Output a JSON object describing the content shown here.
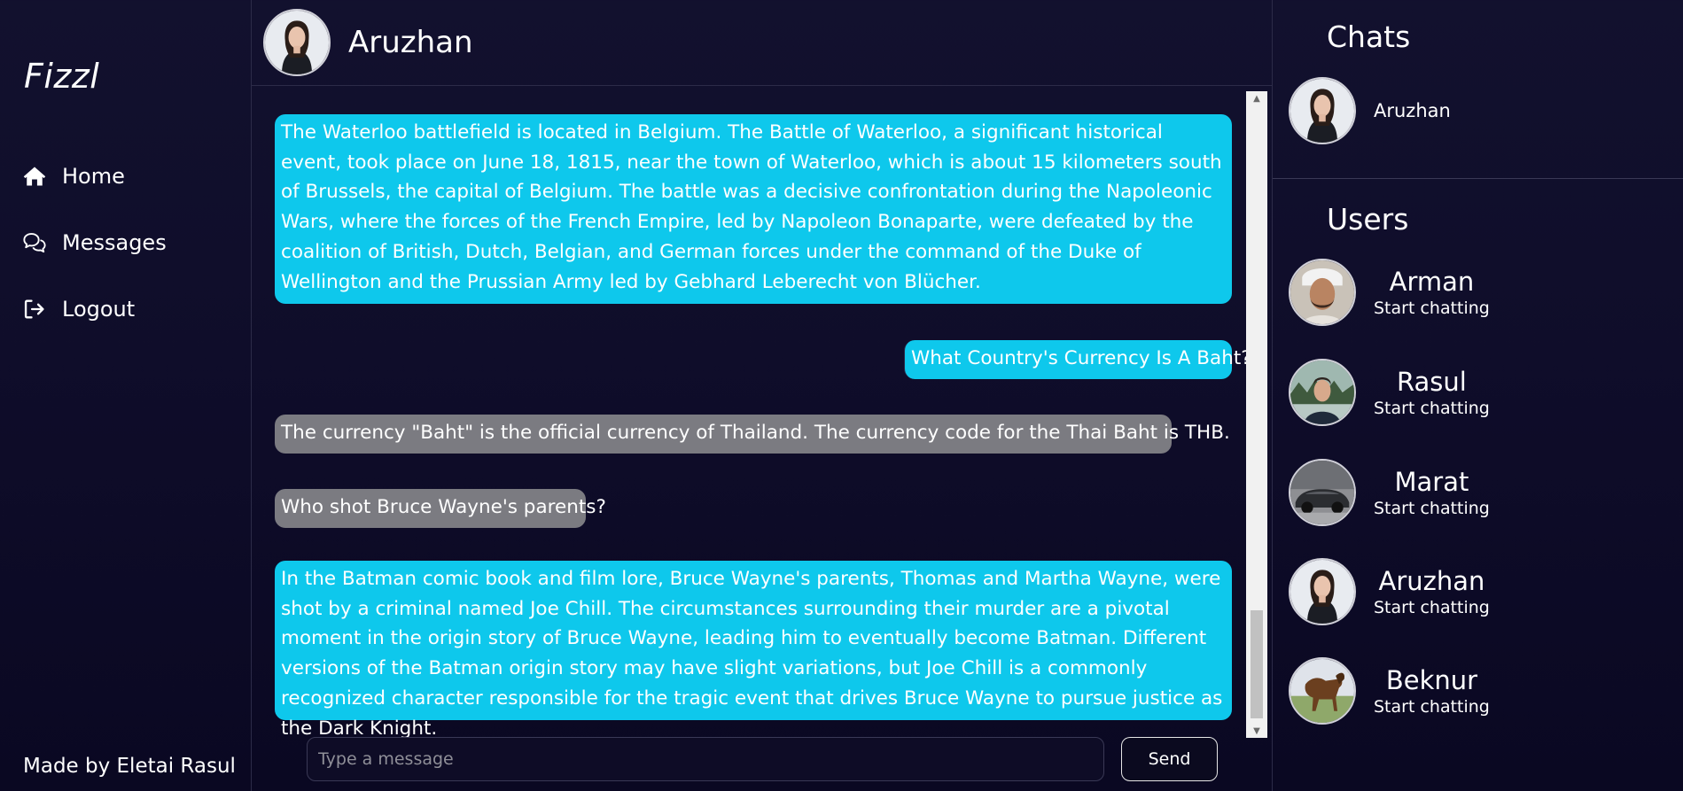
{
  "app": {
    "logo": "Fizzl",
    "credit": "Made by Eletai Rasul"
  },
  "nav": [
    {
      "label": "Home",
      "icon": "home-icon"
    },
    {
      "label": "Messages",
      "icon": "chat-bubbles-icon"
    },
    {
      "label": "Logout",
      "icon": "logout-icon"
    }
  ],
  "chat": {
    "contact_name": "Aruzhan",
    "messages": [
      {
        "type": "bot",
        "text": "The Waterloo battlefield is located in Belgium. The Battle of Waterloo, a significant historical event, took place on June 18, 1815, near the town of Waterloo, which is about 15 kilometers south of Brussels, the capital of Belgium. The battle was a decisive confrontation during the Napoleonic Wars, where the forces of the French Empire, led by Napoleon Bonaparte, were defeated by the coalition of British, Dutch, Belgian, and German forces under the command of the Duke of Wellington and the Prussian Army led by Gebhard Leberecht von Blücher."
      },
      {
        "type": "right",
        "text": "What Country's Currency Is A Baht?"
      },
      {
        "type": "user",
        "text": "The currency \"Baht\" is the official currency of Thailand. The currency code for the Thai Baht is THB."
      },
      {
        "type": "user",
        "text": "Who shot Bruce Wayne's parents?"
      },
      {
        "type": "bot",
        "text": "In the Batman comic book and film lore, Bruce Wayne's parents, Thomas and Martha Wayne, were shot by a criminal named Joe Chill. The circumstances surrounding their murder are a pivotal moment in the origin story of Bruce Wayne, leading him to eventually become Batman. Different versions of the Batman origin story may have slight variations, but Joe Chill is a commonly recognized character responsible for the tragic event that drives Bruce Wayne to pursue justice as the Dark Knight."
      }
    ],
    "input_placeholder": "Type a message",
    "send_label": "Send"
  },
  "sidebar_right": {
    "chats_title": "Chats",
    "chats": [
      {
        "name": "Aruzhan"
      }
    ],
    "users_title": "Users",
    "users": [
      {
        "name": "Arman",
        "sub": "Start chatting"
      },
      {
        "name": "Rasul",
        "sub": "Start chatting"
      },
      {
        "name": "Marat",
        "sub": "Start chatting"
      },
      {
        "name": "Aruzhan",
        "sub": "Start chatting"
      },
      {
        "name": "Beknur",
        "sub": "Start chatting"
      }
    ]
  },
  "colors": {
    "bot_bubble": "#0ec8ec",
    "user_bubble": "#7b7b81",
    "background": "#12112e"
  }
}
